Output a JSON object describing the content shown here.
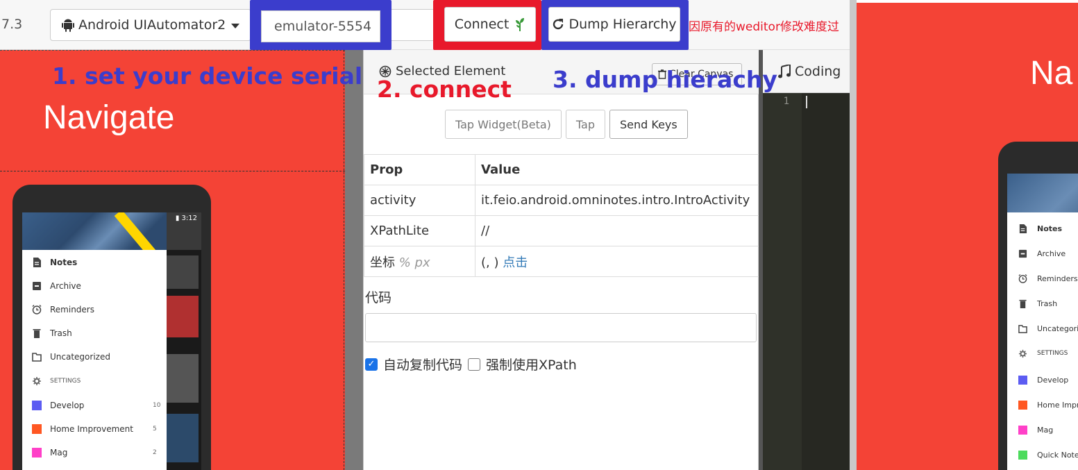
{
  "toolbar": {
    "version": "7.3",
    "platform_label": "Android UIAutomator2",
    "serial_value": "emulator-5554",
    "connect_label": "Connect",
    "dump_label": "Dump Hierarchy",
    "notice": "因原有的weditor修改难度过"
  },
  "screen": {
    "navigate_title": "Navigate",
    "status_time": "3:12",
    "drawer_items": [
      {
        "label": "Notes",
        "icon": "note-icon",
        "count": ""
      },
      {
        "label": "Archive",
        "icon": "archive-icon",
        "count": ""
      },
      {
        "label": "Reminders",
        "icon": "alarm-icon",
        "count": ""
      },
      {
        "label": "Trash",
        "icon": "trash-icon",
        "count": ""
      },
      {
        "label": "Uncategorized",
        "icon": "folder-icon",
        "count": ""
      },
      {
        "label": "SETTINGS",
        "icon": "gear-icon",
        "count": ""
      },
      {
        "label": "Develop",
        "icon": "square-icon",
        "count": "10",
        "color": "#5c5cf2"
      },
      {
        "label": "Home Improvement",
        "icon": "square-icon",
        "count": "5",
        "color": "#ff5722"
      },
      {
        "label": "Mag",
        "icon": "square-icon",
        "count": "2",
        "color": "#ff40c8"
      }
    ]
  },
  "inspector": {
    "selected_title": "Selected Element",
    "clear_label": "Clear Canvas",
    "tap_widget_label": "Tap Widget(Beta)",
    "tap_label": "Tap",
    "send_keys_label": "Send Keys",
    "table_headers": [
      "Prop",
      "Value"
    ],
    "rows": [
      {
        "prop": "activity",
        "value": "it.feio.android.omninotes.intro.IntroActivity"
      },
      {
        "prop": "XPathLite",
        "value": "//"
      }
    ],
    "coord_prop": "坐标",
    "coord_units": "% px",
    "coord_value": "(, )",
    "coord_link": "点击",
    "code_label": "代码",
    "auto_copy_label": "自动复制代码",
    "force_xpath_label": "强制使用XPath",
    "auto_copy_checked": true,
    "force_xpath_checked": false
  },
  "coding": {
    "tab_label": "Coding",
    "line_number": "1"
  },
  "preview": {
    "title_fragment": "Na",
    "items": [
      {
        "label": "Notes",
        "icon": "note-icon"
      },
      {
        "label": "Archive",
        "icon": "archive-icon"
      },
      {
        "label": "Reminders",
        "icon": "alarm-icon"
      },
      {
        "label": "Trash",
        "icon": "trash-icon"
      },
      {
        "label": "Uncategori",
        "icon": "folder-icon"
      },
      {
        "label": "SETTINGS",
        "icon": "gear-icon"
      },
      {
        "label": "Develop",
        "icon": "square-icon",
        "color": "#5c5cf2"
      },
      {
        "label": "Home Impr",
        "icon": "square-icon",
        "color": "#ff5722"
      },
      {
        "label": "Mag",
        "icon": "square-icon",
        "color": "#ff40c8"
      },
      {
        "label": "Quick Note",
        "icon": "square-icon",
        "color": "#4cdb5c"
      }
    ]
  },
  "annotations": {
    "step1": "1. set your device serial",
    "step2": "2. connect",
    "step3": "3. dump hierachy"
  },
  "colors": {
    "accent_blue": "#3b3dcc",
    "accent_red": "#e8192b",
    "screen_red": "#f44336"
  }
}
